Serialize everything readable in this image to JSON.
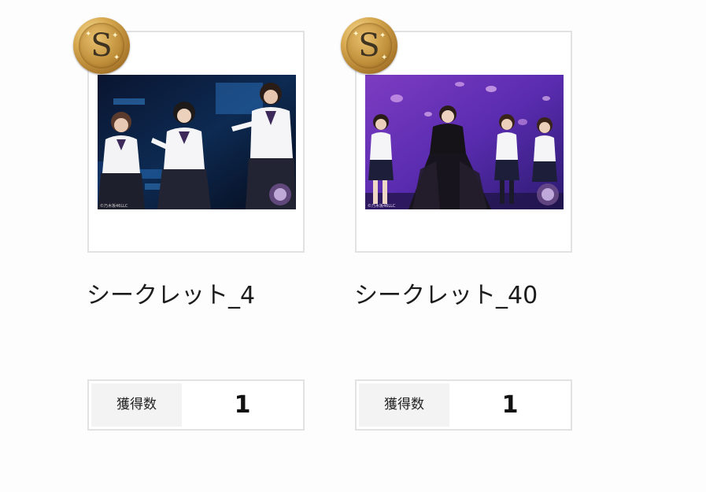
{
  "cards": [
    {
      "rank": "S",
      "name": "シークレット_4",
      "count_label": "獲得数",
      "count_value": "1",
      "copyright": "©乃木坂46LLC"
    },
    {
      "rank": "S",
      "name": "シークレット_40",
      "count_label": "獲得数",
      "count_value": "1",
      "copyright": "©乃木坂46LLC"
    }
  ],
  "colors": {
    "medal_gold": "#d8aa50",
    "frame_border": "#e2e2e2",
    "label_bg": "#f3f3f3"
  },
  "icons": {
    "rank_badge": "gold-coin-medal-icon"
  }
}
